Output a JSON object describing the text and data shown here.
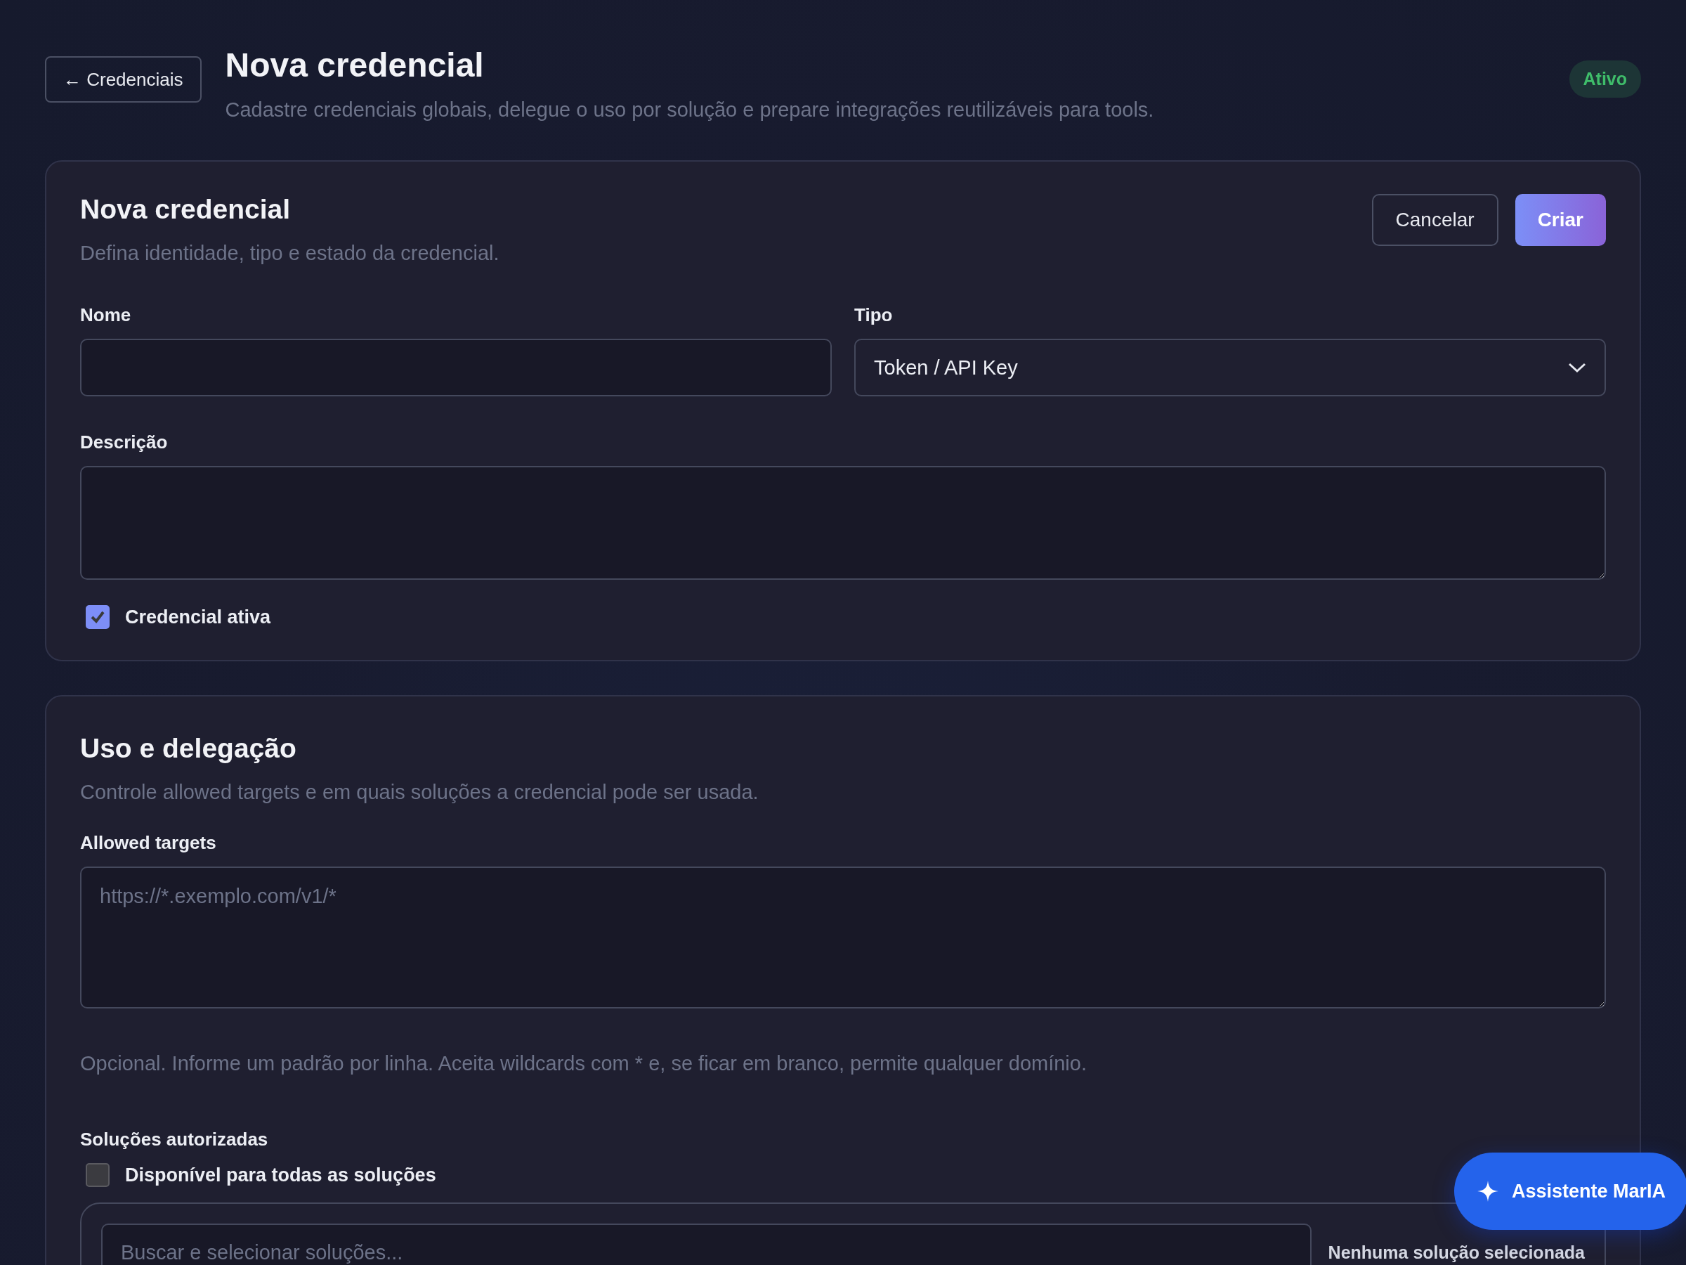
{
  "back_link": {
    "label": "← Credenciais"
  },
  "header": {
    "title": "Nova credencial",
    "subtitle": "Cadastre credenciais globais, delegue o uso por solução e prepare integrações reutilizáveis para tools.",
    "status_badge": "Ativo"
  },
  "identity_card": {
    "title": "Nova credencial",
    "subtitle": "Defina identidade, tipo e estado da credencial.",
    "actions": [
      {
        "label": "Cancelar",
        "kind": "secondary"
      },
      {
        "label": "Criar",
        "kind": "primary"
      }
    ],
    "fields": [
      {
        "label": "Nome",
        "kind": "text"
      },
      {
        "label": "Tipo",
        "kind": "select",
        "value": "Token / API Key"
      },
      {
        "label": "Descrição",
        "kind": "textarea"
      }
    ],
    "active_checkbox": {
      "label": "Credencial ativa",
      "checked": true
    }
  },
  "usage_card": {
    "title": "Uso e delegação",
    "subtitle": "Controle allowed targets e em quais soluções a credencial pode ser usada.",
    "allowed_targets": {
      "label": "Allowed targets",
      "placeholder": "https://*.exemplo.com/v1/*",
      "help": "Opcional. Informe um padrão por linha. Aceita wildcards com * e, se ficar em branco, permite qualquer domínio."
    },
    "solutions": {
      "label": "Soluções autorizadas",
      "all_checkbox": {
        "label": "Disponível para todas as soluções",
        "checked": false
      },
      "search": {
        "placeholder": "Buscar e selecionar soluções..."
      },
      "selection_summary": "Nenhuma solução selecionada"
    }
  },
  "assistant_button": {
    "label": "Assistente MarIA"
  }
}
